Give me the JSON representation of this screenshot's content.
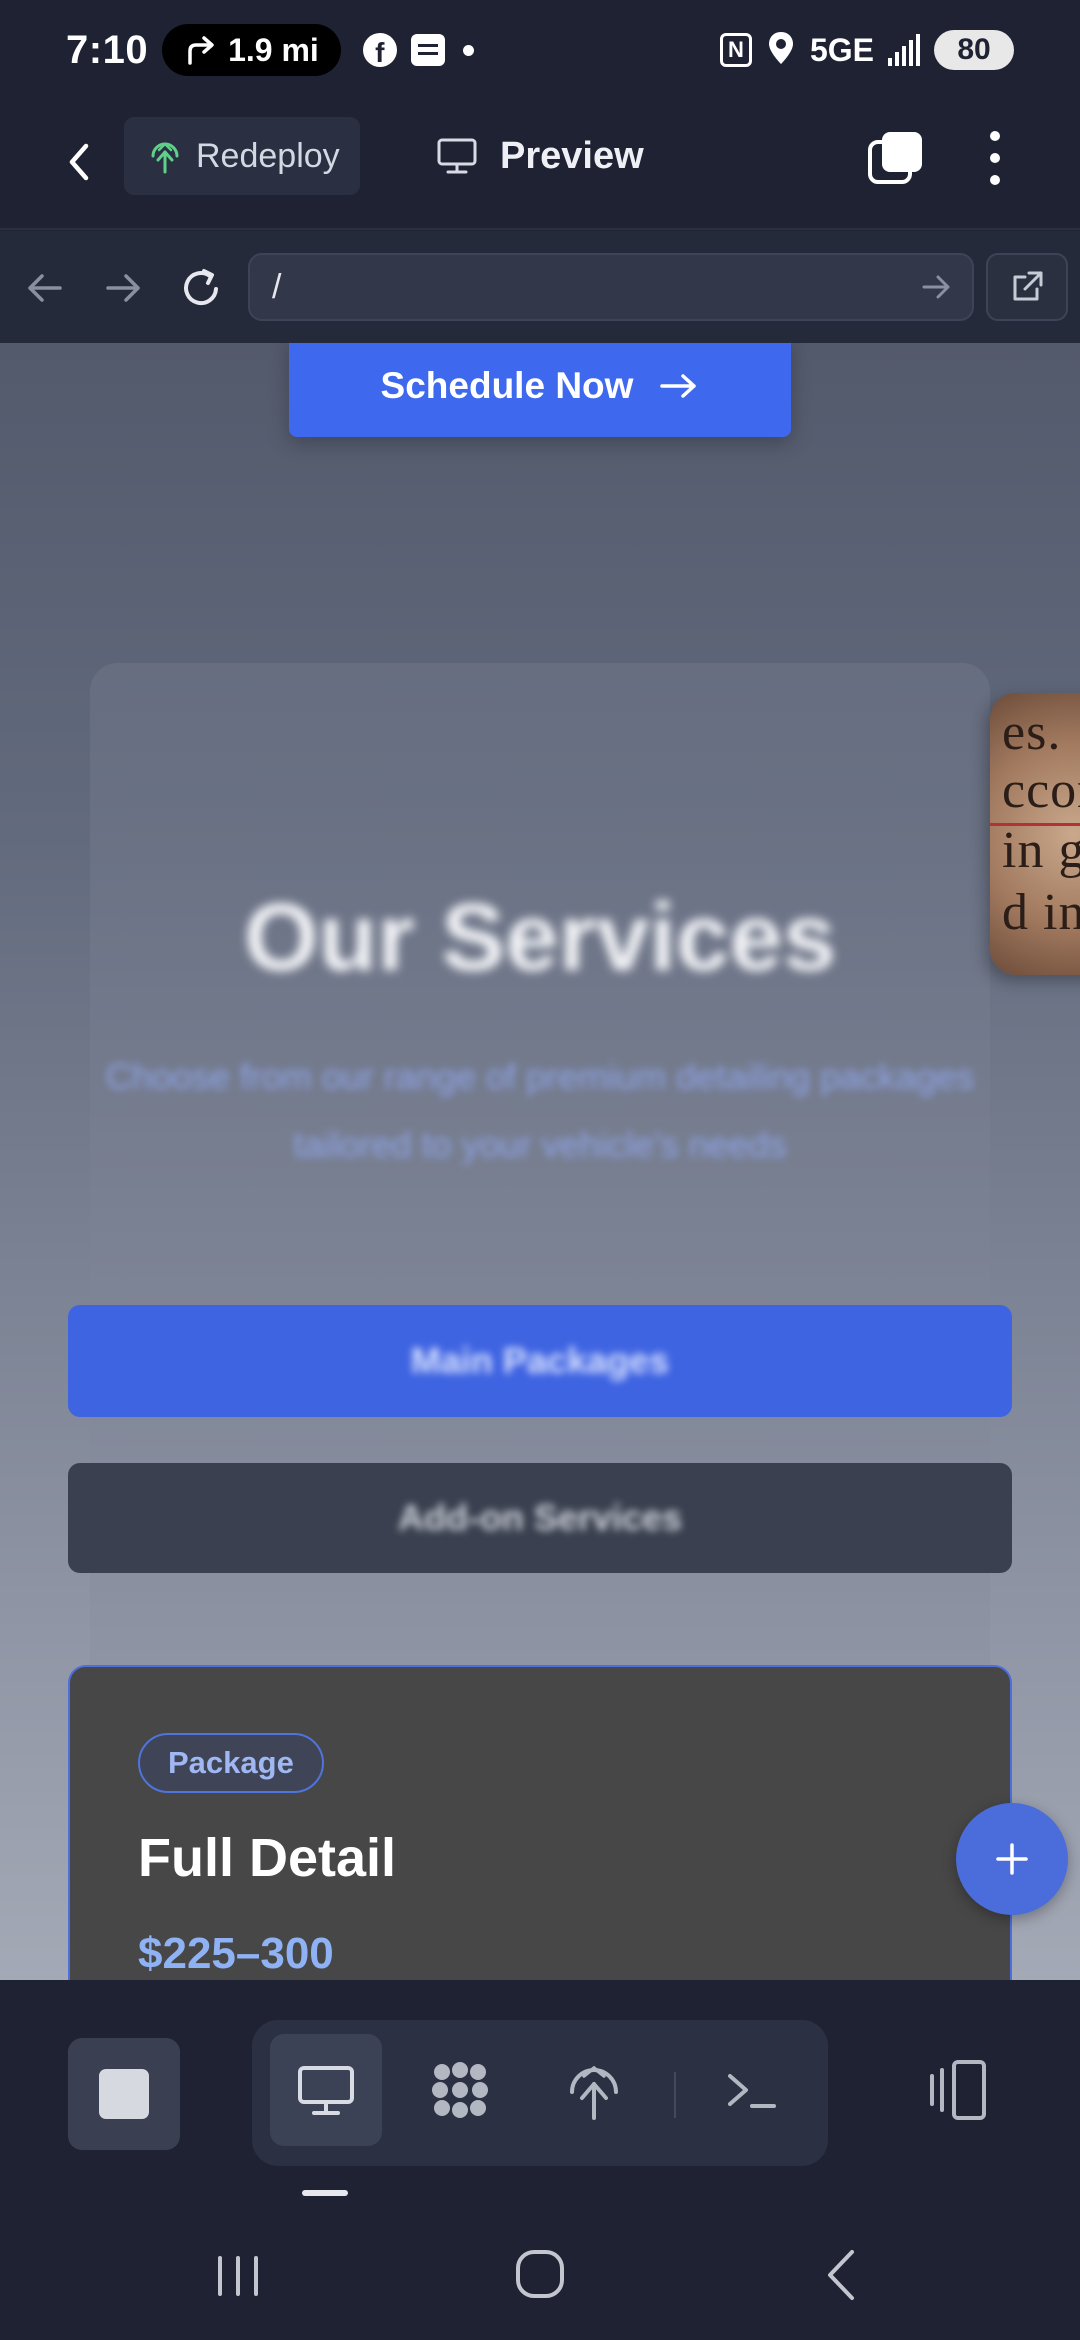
{
  "status_bar": {
    "time": "7:10",
    "navigation_distance": "1.9 mi",
    "network": "5GE",
    "battery": "80",
    "icons": [
      "turn-right-arrow-icon",
      "facebook-icon",
      "message-icon",
      "notification-dot-icon",
      "nfc-icon",
      "location-icon",
      "signal-icon",
      "battery-icon"
    ]
  },
  "toolbar": {
    "redeploy_label": "Redeploy",
    "preview_label": "Preview",
    "icons": [
      "back-arrow-icon",
      "deploy-tree-icon",
      "monitor-icon",
      "tabs-icon",
      "more-vertical-icon"
    ]
  },
  "browser": {
    "url": "/",
    "icons": [
      "nav-back-icon",
      "nav-forward-icon",
      "reload-icon",
      "go-arrow-icon",
      "open-external-icon"
    ]
  },
  "page": {
    "schedule_button": "Schedule Now",
    "services_title": "Our Services",
    "services_subtitle": "Choose from our range of premium detailing packages tailored to your vehicle's needs",
    "main_packages_button": "Main Packages",
    "addon_services_button": "Add-on Services",
    "package_card": {
      "badge": "Package",
      "title": "Full Detail",
      "price": "$225–300"
    },
    "fab_icon": "plus-icon",
    "colors": {
      "primary": "#3e69ee",
      "price": "#8fb2f5",
      "badge_border": "#4f74dc"
    }
  },
  "bottom_toolbar": {
    "icons": [
      "stop-icon",
      "monitor-icon",
      "components-icon",
      "deploy-tree-icon",
      "terminal-icon",
      "layout-toggle-icon"
    ],
    "active_mode": "monitor"
  },
  "system_nav": {
    "icons": [
      "recent-apps-icon",
      "home-icon",
      "system-back-icon"
    ]
  }
}
